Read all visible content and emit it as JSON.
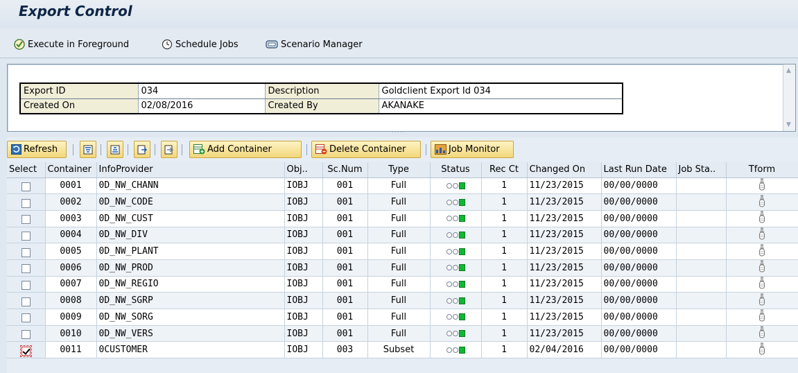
{
  "window": {
    "title": "Export Control"
  },
  "appbar": {
    "execute_label": "Execute in Foreground",
    "schedule_label": "Schedule Jobs",
    "scenario_label": "Scenario Manager"
  },
  "header": {
    "export_id_label": "Export ID",
    "export_id_value": "034",
    "description_label": "Description",
    "description_value": "Goldclient Export Id 034",
    "created_on_label": "Created On",
    "created_on_value": "02/08/2016",
    "created_by_label": "Created By",
    "created_by_value": "AKANAKE"
  },
  "toolbar": {
    "refresh_label": "Refresh",
    "add_container_label": "Add Container",
    "delete_container_label": "Delete Container",
    "job_monitor_label": "Job Monitor"
  },
  "grid": {
    "columns": [
      "Select",
      "Container",
      "InfoProvider",
      "Obj..",
      "Sc.Num",
      "Type",
      "Status",
      "Rec Ct",
      "Changed On",
      "Last Run Date",
      "Job Sta..",
      "Tform"
    ],
    "rows": [
      {
        "container": "0001",
        "infoprovider": "0D_NW_CHANN",
        "obj": "IOBJ",
        "scnum": "001",
        "type": "Full",
        "recct": "1",
        "changed": "11/23/2015",
        "lastrun": "00/00/0000",
        "jobsta": "",
        "checked": false
      },
      {
        "container": "0002",
        "infoprovider": "0D_NW_CODE",
        "obj": "IOBJ",
        "scnum": "001",
        "type": "Full",
        "recct": "1",
        "changed": "11/23/2015",
        "lastrun": "00/00/0000",
        "jobsta": "",
        "checked": false
      },
      {
        "container": "0003",
        "infoprovider": "0D_NW_CUST",
        "obj": "IOBJ",
        "scnum": "001",
        "type": "Full",
        "recct": "1",
        "changed": "11/23/2015",
        "lastrun": "00/00/0000",
        "jobsta": "",
        "checked": false
      },
      {
        "container": "0004",
        "infoprovider": "0D_NW_DIV",
        "obj": "IOBJ",
        "scnum": "001",
        "type": "Full",
        "recct": "1",
        "changed": "11/23/2015",
        "lastrun": "00/00/0000",
        "jobsta": "",
        "checked": false
      },
      {
        "container": "0005",
        "infoprovider": "0D_NW_PLANT",
        "obj": "IOBJ",
        "scnum": "001",
        "type": "Full",
        "recct": "1",
        "changed": "11/23/2015",
        "lastrun": "00/00/0000",
        "jobsta": "",
        "checked": false
      },
      {
        "container": "0006",
        "infoprovider": "0D_NW_PROD",
        "obj": "IOBJ",
        "scnum": "001",
        "type": "Full",
        "recct": "1",
        "changed": "11/23/2015",
        "lastrun": "00/00/0000",
        "jobsta": "",
        "checked": false
      },
      {
        "container": "0007",
        "infoprovider": "0D_NW_REGIO",
        "obj": "IOBJ",
        "scnum": "001",
        "type": "Full",
        "recct": "1",
        "changed": "11/23/2015",
        "lastrun": "00/00/0000",
        "jobsta": "",
        "checked": false
      },
      {
        "container": "0008",
        "infoprovider": "0D_NW_SGRP",
        "obj": "IOBJ",
        "scnum": "001",
        "type": "Full",
        "recct": "1",
        "changed": "11/23/2015",
        "lastrun": "00/00/0000",
        "jobsta": "",
        "checked": false
      },
      {
        "container": "0009",
        "infoprovider": "0D_NW_SORG",
        "obj": "IOBJ",
        "scnum": "001",
        "type": "Full",
        "recct": "1",
        "changed": "11/23/2015",
        "lastrun": "00/00/0000",
        "jobsta": "",
        "checked": false
      },
      {
        "container": "0010",
        "infoprovider": "0D_NW_VERS",
        "obj": "IOBJ",
        "scnum": "001",
        "type": "Full",
        "recct": "1",
        "changed": "11/23/2015",
        "lastrun": "00/00/0000",
        "jobsta": "",
        "checked": false
      },
      {
        "container": "0011",
        "infoprovider": "0CUSTOMER",
        "obj": "IOBJ",
        "scnum": "003",
        "type": "Subset",
        "recct": "1",
        "changed": "02/04/2016",
        "lastrun": "00/00/0000",
        "jobsta": "",
        "checked": true
      }
    ]
  },
  "icons": {
    "status": "traffic-light-green-icon",
    "tform": "transform-icon"
  },
  "colors": {
    "title": "#0e2646",
    "button_bg": "#f2d77b",
    "status_green": "#0fb833",
    "label_cell_bg": "#f1eed8"
  }
}
